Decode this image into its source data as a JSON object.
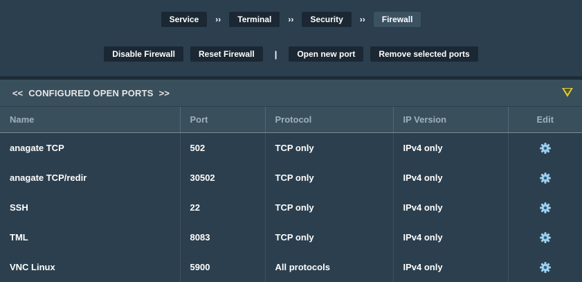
{
  "breadcrumb": {
    "items": [
      "Service",
      "Terminal",
      "Security",
      "Firewall"
    ],
    "separator": "››"
  },
  "actions": {
    "disable": "Disable Firewall",
    "reset": "Reset Firewall",
    "separator": "|",
    "open_port": "Open new port",
    "remove": "Remove selected ports"
  },
  "section": {
    "prev": "<<",
    "title": "CONFIGURED OPEN PORTS",
    "next": ">>"
  },
  "table": {
    "headers": [
      "Name",
      "Port",
      "Protocol",
      "IP Version",
      "Edit"
    ],
    "rows": [
      {
        "name": "anagate TCP",
        "port": "502",
        "protocol": "TCP only",
        "ip": "IPv4 only"
      },
      {
        "name": "anagate TCP/redir",
        "port": "30502",
        "protocol": "TCP only",
        "ip": "IPv4 only"
      },
      {
        "name": "SSH",
        "port": "22",
        "protocol": "TCP only",
        "ip": "IPv4 only"
      },
      {
        "name": "TML",
        "port": "8083",
        "protocol": "TCP only",
        "ip": "IPv4 only"
      },
      {
        "name": "VNC Linux",
        "port": "5900",
        "protocol": "All protocols",
        "ip": "IPv4 only"
      }
    ]
  },
  "colors": {
    "background": "#2b3f4e",
    "header": "#3a4f5c",
    "button": "#1b2833",
    "accent_triangle": "#d9cc3a",
    "gear": "#9fd0ee"
  },
  "icons": {
    "edit": "gear-icon",
    "collapse": "triangle-down-icon"
  }
}
